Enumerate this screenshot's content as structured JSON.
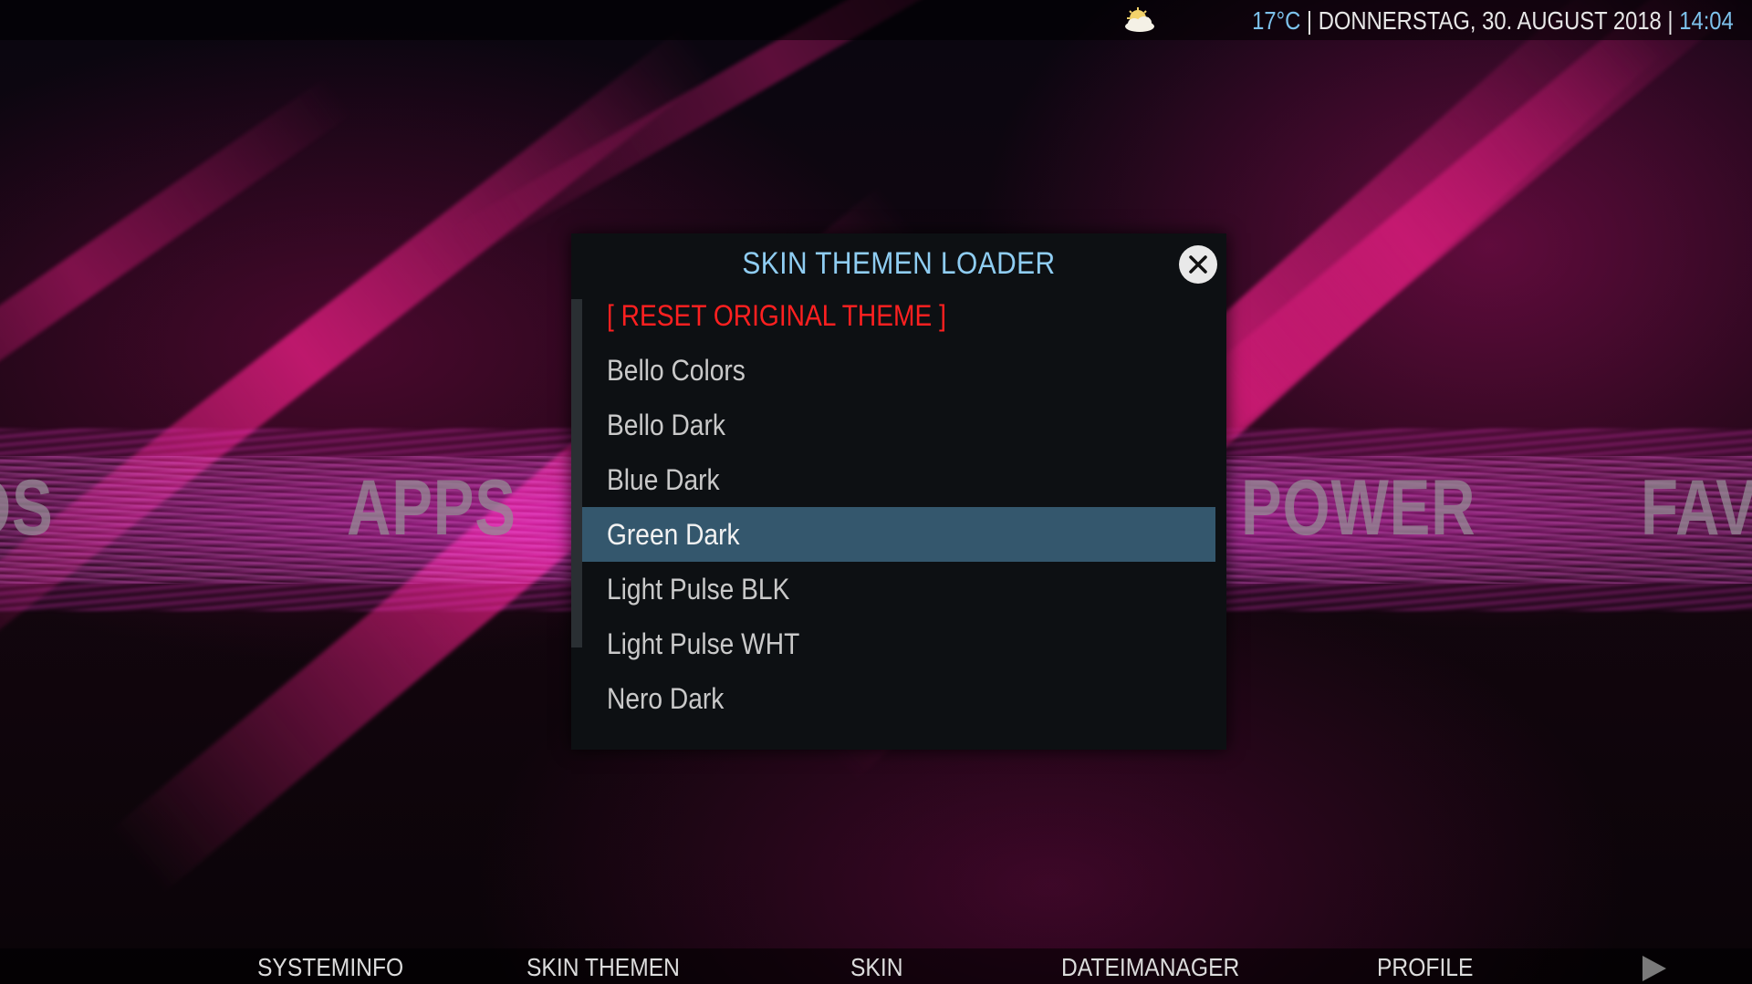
{
  "header": {
    "temperature": "17°C",
    "separator": "|",
    "date": "DONNERSTAG, 30. AUGUST 2018",
    "time": "14:04",
    "weather_icon": "sun-cloud-icon"
  },
  "background_menu": {
    "items": [
      "OS",
      "APPS",
      "POWER",
      "FAVO"
    ]
  },
  "dialog": {
    "title": "SKIN THEMEN LOADER",
    "close_icon": "close-icon",
    "items": [
      {
        "label": "[ RESET ORIGINAL THEME ]"
      },
      {
        "label": "Bello Colors"
      },
      {
        "label": "Bello Dark"
      },
      {
        "label": "Blue Dark"
      },
      {
        "label": "Green Dark",
        "selected": true
      },
      {
        "label": "Light Pulse BLK"
      },
      {
        "label": "Light Pulse WHT"
      },
      {
        "label": "Nero Dark"
      }
    ],
    "colors": {
      "title": "#8fcdf2",
      "reset": "#ff2020",
      "selected_bg": "#34576d"
    }
  },
  "bottom_menu": {
    "items": [
      "SYSTEMINFO",
      "SKIN THEMEN",
      "SKIN",
      "DATEIMANAGER",
      "PROFILE"
    ],
    "next_icon": "arrow-right-icon"
  }
}
